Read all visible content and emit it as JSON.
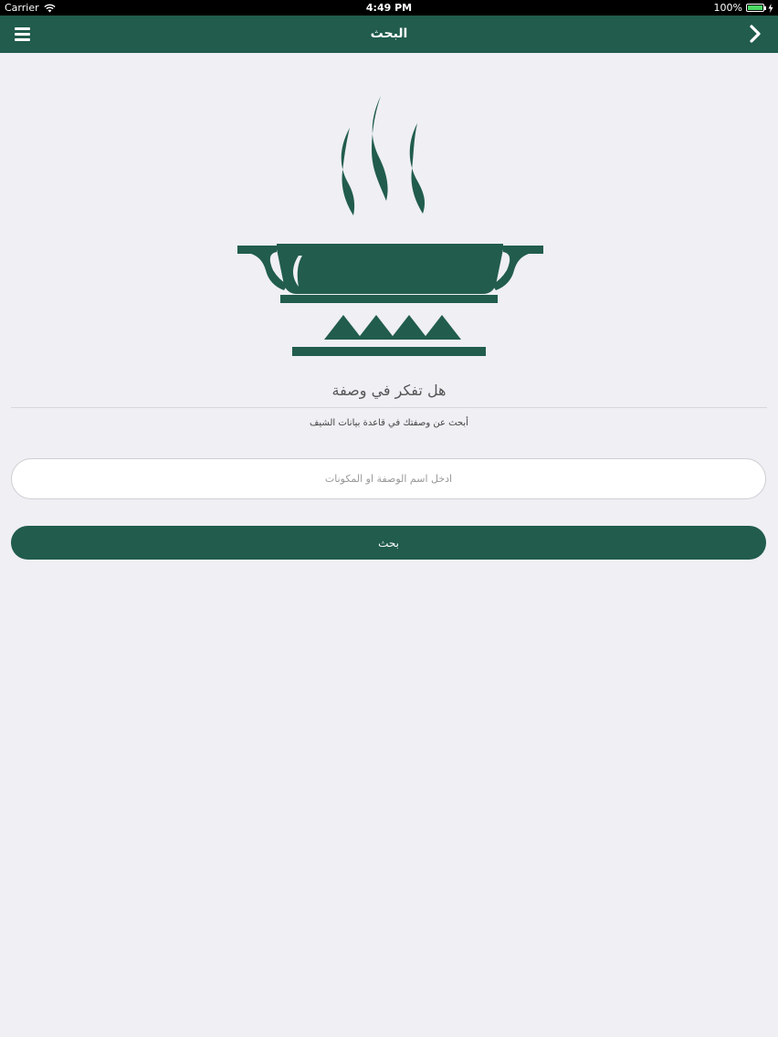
{
  "status_bar": {
    "carrier": "Carrier",
    "time": "4:49 PM",
    "battery": "100%"
  },
  "navbar": {
    "title": "البحث",
    "menu_icon": "hamburger-menu-icon",
    "forward_icon": "chevron-right-icon"
  },
  "main": {
    "question": "هل تفكر في وصفة",
    "subtitle": "أبحث عن وصفتك في قاعدة بيانات الشيف",
    "search_placeholder": "ادخل اسم الوصفة او المكونات",
    "search_value": "",
    "search_button_label": "بحث"
  },
  "colors": {
    "brand": "#215c4c",
    "background": "#efeff4"
  }
}
